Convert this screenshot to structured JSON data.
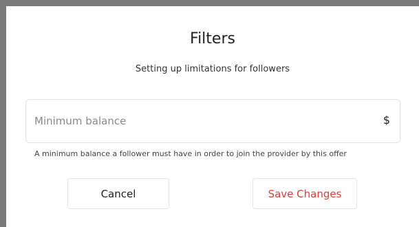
{
  "dialog": {
    "title": "Filters",
    "subtitle": "Setting up limitations for followers",
    "minimum_balance": {
      "placeholder": "Minimum balance",
      "value": "",
      "currency_symbol": "$",
      "hint": "A minimum balance a follower must have in order to join the provider by this offer"
    },
    "buttons": {
      "cancel_label": "Cancel",
      "save_label": "Save Changes"
    }
  },
  "colors": {
    "backdrop": "#7a7a7a",
    "save_text": "#e53935"
  }
}
